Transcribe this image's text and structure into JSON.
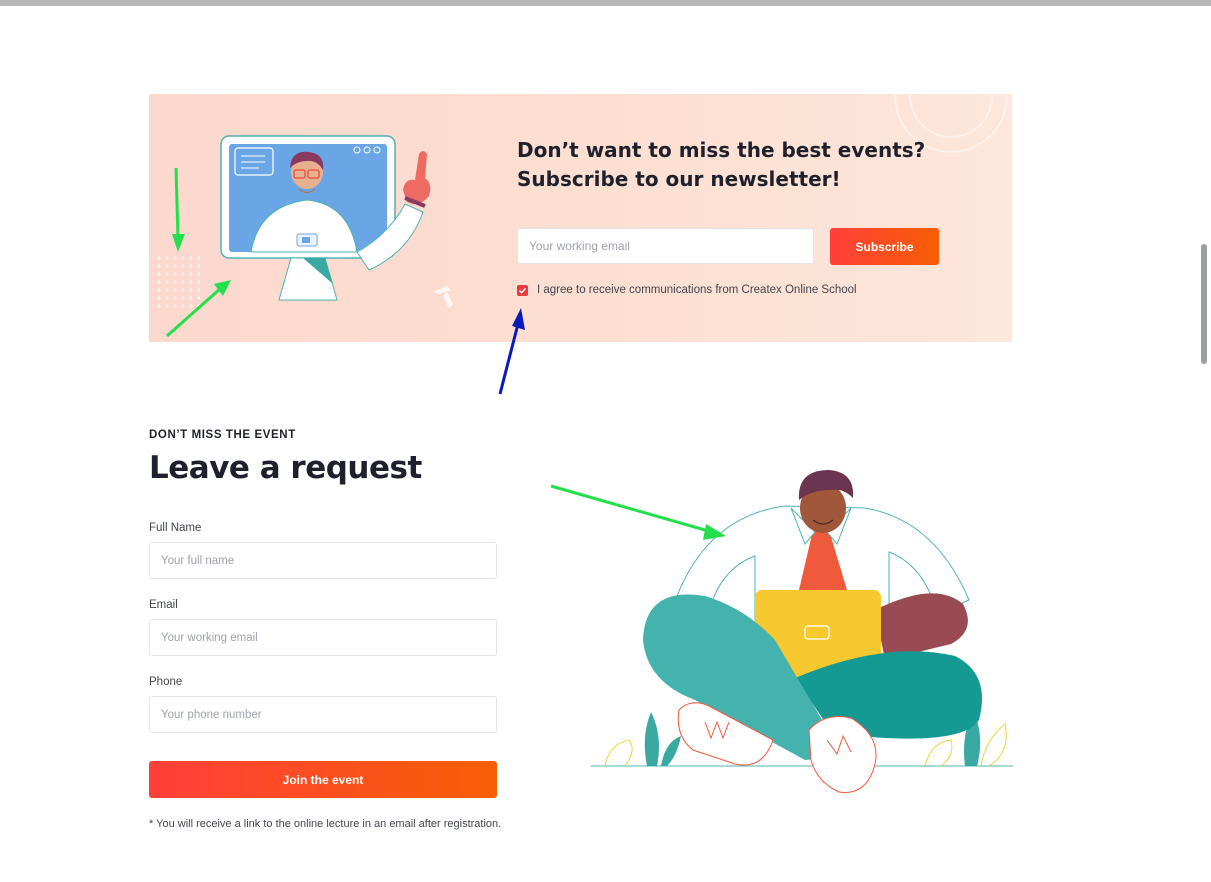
{
  "newsletter": {
    "title_line1": "Don’t want to miss the best events?",
    "title_line2": "Subscribe to our newsletter!",
    "email_placeholder": "Your working email",
    "subscribe_label": "Subscribe",
    "agree_checked": true,
    "agree_text": "I agree to receive communications from Createx Online School"
  },
  "request": {
    "eyebrow": "DON’T MISS THE EVENT",
    "heading": "Leave a request",
    "fields": [
      {
        "label": "Full Name",
        "placeholder": "Your full name"
      },
      {
        "label": "Email",
        "placeholder": "Your working email"
      },
      {
        "label": "Phone",
        "placeholder": "Your phone number"
      }
    ],
    "submit_label": "Join the event",
    "note": "* You will receive a link to the online lecture in an email after registration."
  },
  "colors": {
    "accent_gradient_start": "#ff3f3a",
    "accent_gradient_end": "#f75e05",
    "banner_bg": "#fcd8cd",
    "annotation_green": "#22e04a",
    "annotation_blue": "#0a1ab8"
  },
  "icons": [
    "check-icon",
    "video-call-illustration",
    "person-with-laptop-illustration",
    "arrow-annotation"
  ]
}
